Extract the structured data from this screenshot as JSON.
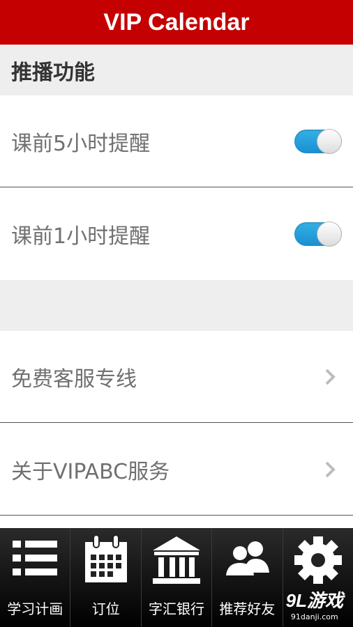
{
  "header": {
    "title": "VIP Calendar"
  },
  "push_section": {
    "title": "推播功能",
    "rows": [
      {
        "label": "课前5小时提醒",
        "toggle_on": true
      },
      {
        "label": "课前1小时提醒",
        "toggle_on": true
      }
    ]
  },
  "menu_section": {
    "rows": [
      {
        "label": "免费客服专线"
      },
      {
        "label": "关于VIPABC服务"
      }
    ]
  },
  "tabbar": {
    "tabs": [
      {
        "label": "学习计画",
        "icon": "list-icon"
      },
      {
        "label": "订位",
        "icon": "calendar-icon"
      },
      {
        "label": "字汇银行",
        "icon": "bank-icon"
      },
      {
        "label": "推荐好友",
        "icon": "people-icon"
      },
      {
        "label": "",
        "icon": "gear-icon"
      }
    ]
  },
  "watermark": {
    "logo": "9L游戏",
    "url": "91danji.com"
  },
  "colors": {
    "header": "#c40000",
    "toggle": "#1a8fd0",
    "section_bg": "#eeeeee"
  }
}
